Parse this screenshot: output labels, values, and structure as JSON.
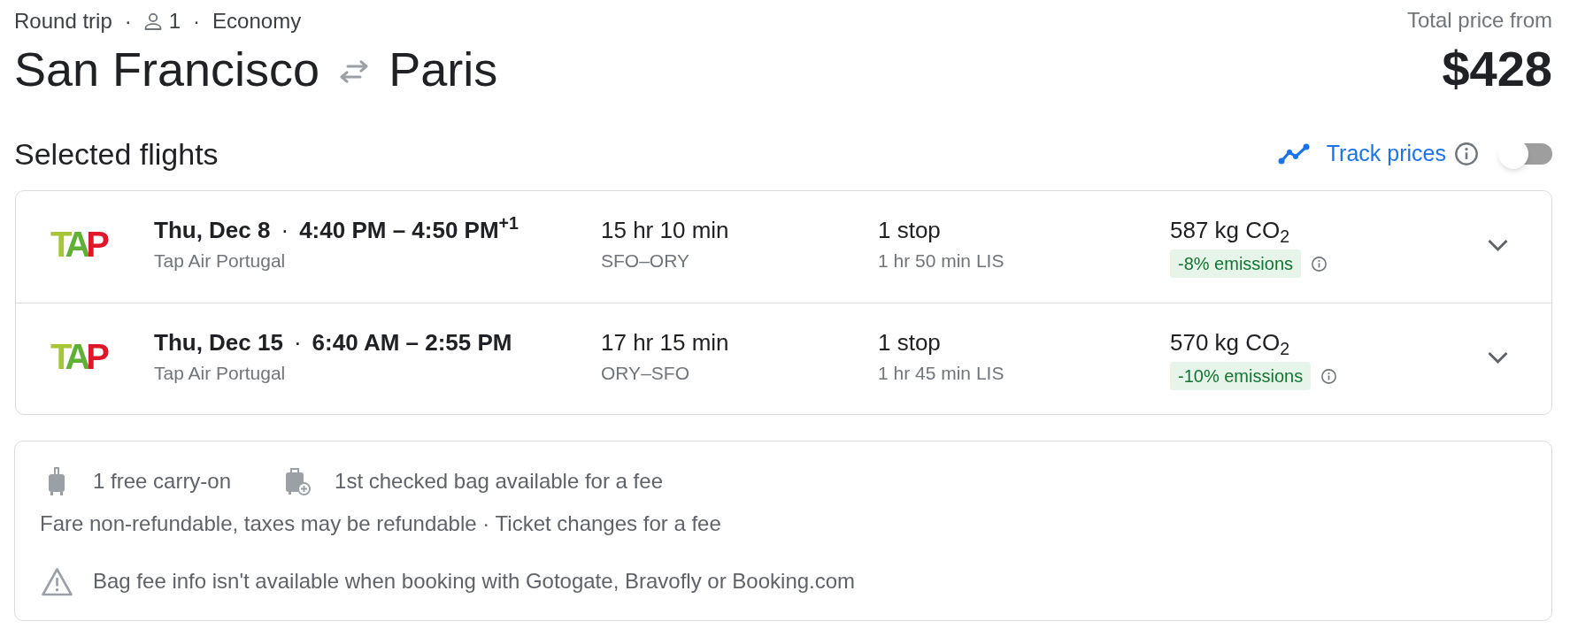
{
  "trip_summary": {
    "trip_type": "Round trip",
    "separator_1": "·",
    "passengers": "1",
    "separator_2": "·",
    "cabin_class": "Economy"
  },
  "route": {
    "origin": "San Francisco",
    "destination": "Paris"
  },
  "price": {
    "label": "Total price from",
    "amount": "$428"
  },
  "section": {
    "title": "Selected flights",
    "track_prices": {
      "label": "Track prices",
      "on": false
    }
  },
  "flights": [
    {
      "logo": "TAP",
      "date": "Thu, Dec 8",
      "separator": "·",
      "times": "4:40 PM – 4:50 PM$^{+1}$",
      "airline": "Tap Air Portugal",
      "duration": "15 hr 10 min",
      "airports": "SFO–ORY",
      "stops": "1 stop",
      "layover": "1 hr 50 min LIS",
      "emissions": "587 kg CO$_{2}$",
      "emissions_change": "-8% emissions",
      "expanded": false
    },
    {
      "logo": "TAP",
      "date": "Thu, Dec 15",
      "separator": "·",
      "times": "6:40 AM – 2:55 PM",
      "airline": "Tap Air Portugal",
      "duration": "17 hr 15 min",
      "airports": "ORY–SFO",
      "stops": "1 stop",
      "layover": "1 hr 45 min LIS",
      "emissions": "570 kg CO$_{2}$",
      "emissions_change": "-10% emissions",
      "expanded": false
    }
  ],
  "details": {
    "baggage": [
      {
        "kind": "carry_on",
        "text": "1 free carry-on"
      },
      {
        "kind": "checked",
        "text": "1st checked bag available for a fee"
      }
    ],
    "fare_terms": "Fare non-refundable, taxes may be refundable · Ticket changes for a fee",
    "warning": "Bag fee info isn't available when booking with Gotogate, Bravofly or Booking.com"
  }
}
